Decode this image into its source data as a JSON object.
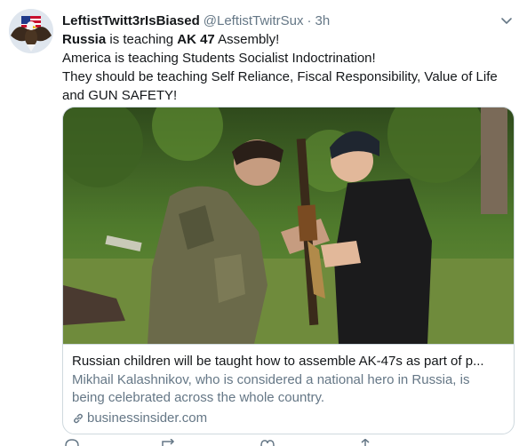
{
  "tweet": {
    "display_name": "LeftistTwitt3rIsBiased",
    "handle": "@LeftistTwitrSux",
    "separator": "·",
    "time": "3h",
    "lines": [
      {
        "bold": "Russia",
        "rest": " is teaching "
      },
      {
        "bold": "AK 47",
        "rest": " Assembly!"
      }
    ],
    "line2": "America is teaching Students Socialist Indoctrination!",
    "line3": "They should be teaching Self Reliance, Fiscal Responsibility, Value of Life and GUN SAFETY!"
  },
  "card": {
    "title": "Russian children will be taught how to assemble AK-47s as part of p...",
    "description": "Mikhail Kalashnikov, who is considered a national hero in Russia, is being celebrated across the whole country.",
    "domain": "businessinsider.com"
  },
  "icons": {
    "menu": "chevron-down-icon",
    "link": "link-icon",
    "avatar": "eagle-flag-avatar"
  },
  "colors": {
    "text_primary": "#14171a",
    "text_secondary": "#657786",
    "border": "#cfd9de"
  }
}
